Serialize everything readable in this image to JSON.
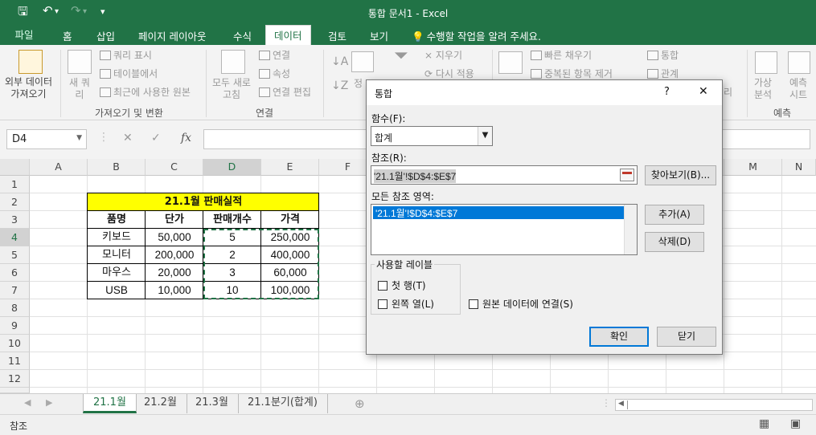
{
  "window": {
    "title": "통합 문서1 - Excel"
  },
  "quick_access": {
    "save": "🖫",
    "undo": "↶",
    "redo": "↷",
    "customize": "▾"
  },
  "ribbon_tabs": {
    "file": "파일",
    "items": [
      "홈",
      "삽입",
      "페이지 레이아웃",
      "수식",
      "데이터",
      "검토",
      "보기"
    ],
    "active": "데이터",
    "tell_me": "수행할 작업을 알려 주세요."
  },
  "ribbon": {
    "external_data": "외부 데이터\n가져오기",
    "new_query": "새 쿼\n리",
    "show_query": "쿼리 표시",
    "from_table": "테이블에서",
    "recent_sources": "최근에 사용한 원본",
    "group_get_transform": "가져오기 및 변환",
    "refresh_all": "모두 새로\n고침",
    "connections": "연결",
    "properties": "속성",
    "edit_links": "연결 편집",
    "group_connections": "연결",
    "sort": "정",
    "clear": "지우기",
    "reapply": "다시 적용",
    "flash_fill": "빠른 채우기",
    "remove_duplicates": "중복된 항목 제거",
    "consolidate": "통합",
    "relationships": "관계",
    "manage": "리",
    "what_if": "가상\n분석",
    "forecast_sheet": "예측\n시트",
    "group_forecast": "예측"
  },
  "formula_bar": {
    "name_box": "D4",
    "fx": "fx",
    "cancel": "✕",
    "enter": "✓",
    "value": ""
  },
  "columns": [
    "A",
    "B",
    "C",
    "D",
    "E",
    "F",
    "M",
    "N"
  ],
  "rows": [
    "1",
    "2",
    "3",
    "4",
    "5",
    "6",
    "7",
    "8",
    "9",
    "10",
    "11",
    "12"
  ],
  "sheet": {
    "title": "21.1월 판매실적",
    "headers": [
      "품명",
      "단가",
      "판매개수",
      "가격"
    ],
    "rows": [
      [
        "키보드",
        "50,000",
        "5",
        "250,000"
      ],
      [
        "모니터",
        "200,000",
        "2",
        "400,000"
      ],
      [
        "마우스",
        "20,000",
        "3",
        "60,000"
      ],
      [
        "USB",
        "10,000",
        "10",
        "100,000"
      ]
    ],
    "title_fill": "#ffff00"
  },
  "sheet_tabs": {
    "items": [
      "21.1월",
      "21.2월",
      "21.3월",
      "21.1분기(합계)"
    ],
    "active": "21.1월",
    "add": "⊕"
  },
  "status": {
    "text": "참조"
  },
  "dialog": {
    "title": "통합",
    "help": "?",
    "close": "✕",
    "function_label": "함수(F):",
    "function_value": "합계",
    "reference_label": "참조(R):",
    "reference_value": "'21.1월'!$D$4:$E$7",
    "browse": "찾아보기(B)...",
    "all_refs_label": "모든 참조 영역:",
    "all_refs": [
      "'21.1월'!$D$4:$E$7"
    ],
    "add": "추가(A)",
    "delete": "삭제(D)",
    "labels_group": "사용할 레이블",
    "top_row": "첫 행(T)",
    "left_column": "왼쪽 열(L)",
    "link_source": "원본 데이터에 연결(S)",
    "ok": "확인",
    "close_button": "닫기"
  },
  "colors": {
    "excel_green": "#217346",
    "selection_blue": "#0078d7"
  }
}
